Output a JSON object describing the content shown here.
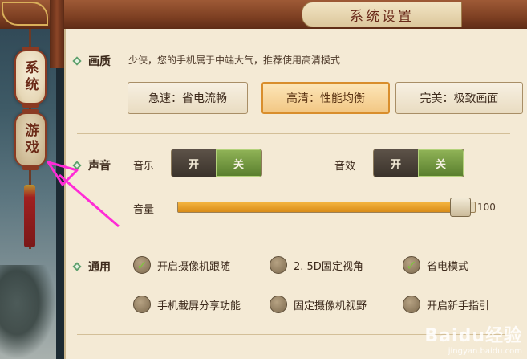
{
  "header": {
    "title": "系统设置"
  },
  "side_tabs": [
    {
      "label": "系统",
      "active": true
    },
    {
      "label": "游戏",
      "active": false
    }
  ],
  "quality": {
    "label": "画质",
    "hint": "少侠，您的手机属于中端大气，推荐使用高清模式",
    "options": [
      {
        "label": "急速：省电流畅",
        "selected": false
      },
      {
        "label": "高清：性能均衡",
        "selected": true
      },
      {
        "label": "完美：极致画面",
        "selected": false
      }
    ]
  },
  "sound": {
    "label": "声音",
    "music": {
      "label": "音乐",
      "on_label": "开",
      "off_label": "关",
      "state": "关"
    },
    "effects": {
      "label": "音效",
      "on_label": "开",
      "off_label": "关",
      "state": "关"
    },
    "volume": {
      "label": "音量",
      "value": 100,
      "max": 100,
      "display": "100"
    }
  },
  "general": {
    "label": "通用",
    "options": [
      {
        "label": "开启摄像机跟随",
        "checked": true
      },
      {
        "label": "2. 5D固定视角",
        "checked": false
      },
      {
        "label": "省电模式",
        "checked": true
      },
      {
        "label": "手机截屏分享功能",
        "checked": false
      },
      {
        "label": "固定摄像机视野",
        "checked": false
      },
      {
        "label": "开启新手指引",
        "checked": false
      }
    ]
  },
  "watermark": {
    "brand": "Baidu经验",
    "url": "jingyan.baidu.com"
  },
  "colors": {
    "accent": "#d98e2c",
    "toggle_active": "#6f9a3a",
    "annotation_arrow": "#ff2bd6"
  }
}
